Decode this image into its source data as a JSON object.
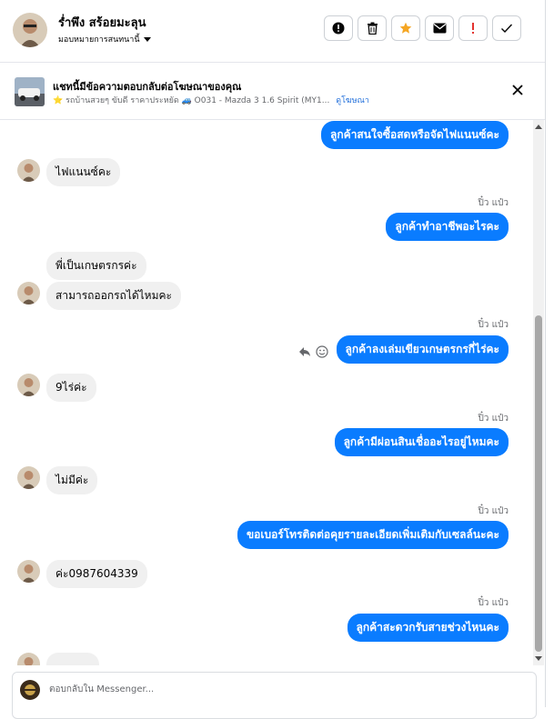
{
  "header": {
    "user_name": "ร่ำพึง สร้อยมะลุน",
    "assign_label": "มอบหมายการสนทนานี้",
    "actions": [
      {
        "name": "mark-spam-button",
        "icon": "alert-circle-icon"
      },
      {
        "name": "delete-button",
        "icon": "trash-icon"
      },
      {
        "name": "star-button",
        "icon": "star-icon"
      },
      {
        "name": "mark-unread-button",
        "icon": "envelope-icon"
      },
      {
        "name": "follow-up-button",
        "icon": "exclamation-icon"
      },
      {
        "name": "mark-done-button",
        "icon": "check-icon"
      }
    ],
    "star_color": "#f5a623",
    "follow_up_color": "#e4332f"
  },
  "ad": {
    "title": "แชทนี้มีข้อความตอบกลับต่อโฆษณาของคุณ",
    "subtitle": "⭐ รถบ้านสวยๆ ขับดี ราคาประหยัด 🚙 O031 - Mazda 3 1.6 Spirit (MY1...",
    "link": "ดูโฆษณา"
  },
  "messages": {
    "m1": "ลูกค้าสนใจซื้อสดหรือจัดไฟแนนซ์คะ",
    "m2": "ไฟแนนซ์คะ",
    "m3_sender": "ปิ๋ว แป๋ว",
    "m3": "ลูกค้าทำอาชีพอะไรคะ",
    "m4": "พี่เป็นเกษตรกรค่ะ",
    "m5": "สามารถออกรถได้ไหมคะ",
    "m6_sender": "ปิ๋ว แป๋ว",
    "m6": "ลูกค้าลงเล่มเขียวเกษตรกรกี่ไร่คะ",
    "m7": "9ไร่ค่ะ",
    "m8_sender": "ปิ๋ว แป๋ว",
    "m8": "ลูกค้ามีผ่อนสินเชื่ออะไรอยู่ไหมคะ",
    "m9": "ไม่มีค่ะ",
    "m10_sender": "ปิ๋ว แป๋ว",
    "m10": "ขอเบอร์โทรติดต่อคุยรายละเอียดเพิ่มเติมกับเซลล์นะคะ",
    "m11": "ค่ะ0987604339",
    "m12_sender": "ปิ๋ว แป๋ว",
    "m12": "ลูกค้าสะดวกรับสายช่วงไหนคะ"
  },
  "composer": {
    "placeholder": "ตอบกลับใน Messenger..."
  },
  "colors": {
    "outgoing_bubble": "#0a7cff",
    "incoming_bubble": "#f0f0f0",
    "link": "#216fdb"
  }
}
